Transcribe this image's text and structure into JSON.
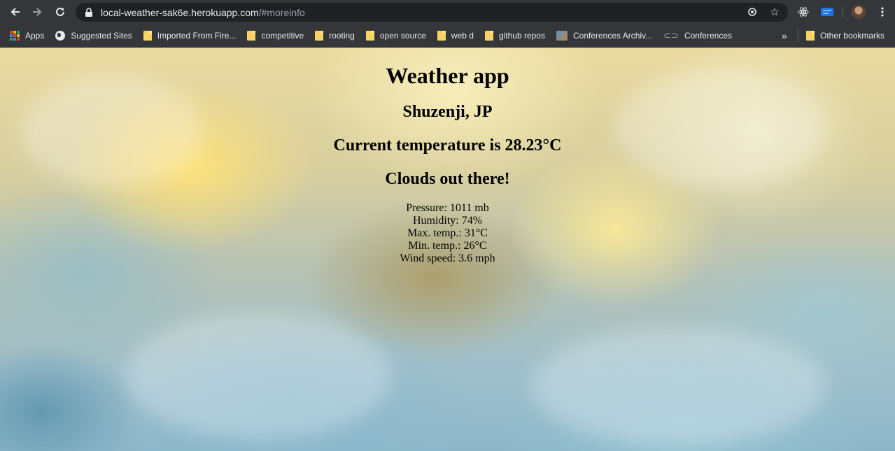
{
  "browser": {
    "url_host": "local-weather-sak6e.herokuapp.com",
    "url_path": "/#moreinfo",
    "bookmarks": [
      {
        "label": "Apps",
        "icon": "apps-grid-icon"
      },
      {
        "label": "Suggested Sites",
        "icon": "globe-icon"
      },
      {
        "label": "Imported From Fire...",
        "icon": "folder-icon"
      },
      {
        "label": "competitive",
        "icon": "folder-icon"
      },
      {
        "label": "rooting",
        "icon": "folder-icon"
      },
      {
        "label": "open source",
        "icon": "folder-icon"
      },
      {
        "label": "web d",
        "icon": "folder-icon"
      },
      {
        "label": "github repos",
        "icon": "folder-icon"
      },
      {
        "label": "Conferences Archiv...",
        "icon": "conference-site-icon"
      },
      {
        "label": "Conferences",
        "icon": "link-icon"
      }
    ],
    "more_bookmarks": "»",
    "other_bookmarks": "Other bookmarks"
  },
  "page": {
    "title": "Weather app",
    "location": "Shuzenji, JP",
    "temperature_text": "Current temperature is 28.23°C",
    "description": "Clouds out there!",
    "details": [
      "Pressure: 1011 mb",
      "Humidity: 74%",
      "Max. temp.: 31°C",
      "Min. temp.: 26°C",
      "Wind speed: 3.6 mph"
    ]
  }
}
